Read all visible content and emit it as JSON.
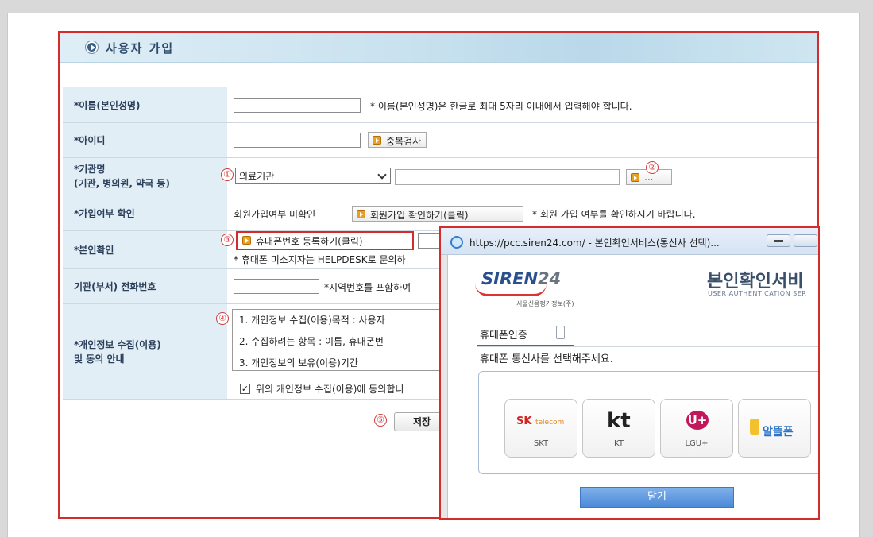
{
  "page": {
    "title": "사용자 가입"
  },
  "form": {
    "name": {
      "label": "*이름(본인성명)",
      "value": "",
      "note": "* 이름(본인성명)은 한글로 최대 5자리 이내에서 입력해야 합니다."
    },
    "userid": {
      "label": "*아이디",
      "value": "",
      "check_button": "중복검사"
    },
    "org": {
      "label_line1": "*기관명",
      "label_line2": "(기관, 병의원, 약국 등)",
      "select_value": "의료기관",
      "input_value": "",
      "search_button": "..."
    },
    "join_check": {
      "label": "*가입여부 확인",
      "status": "회원가입여부 미확인",
      "button": "회원가입 확인하기(클릭)",
      "note": "* 회원 가입 여부를 확인하시기 바랍니다."
    },
    "identity": {
      "label": "*본인확인",
      "button": "휴대폰번호 등록하기(클릭)",
      "note": "* 휴대폰 미소지자는 HELPDESK로 문의하"
    },
    "phone": {
      "label": "기관(부서) 전화번호",
      "value": "",
      "note": "*지역번호를 포함하여 "
    },
    "privacy": {
      "label_line1": "*개인정보 수집(이용)",
      "label_line2": "및 동의 안내",
      "lines": [
        "1. 개인정보 수집(이용)목적 : 사용자",
        "2. 수집하려는 항목 : 이름, 휴대폰번",
        "3. 개인정보의 보유(이용)기간"
      ],
      "agree_label": "위의 개인정보 수집(이용)에 동의합니",
      "agree_checked": true
    },
    "save_button": "저장"
  },
  "markers": [
    "①",
    "②",
    "③",
    "④",
    "⑤"
  ],
  "popup": {
    "window_title": "https://pcc.siren24.com/ - 본인확인서비스(통신사 선택)...",
    "brand": "SIREN",
    "brand_num": "24",
    "brand_sub": "서울신용평가정보(주)",
    "service_title": "본인확인서비",
    "service_sub": "USER AUTHENTICATION SER",
    "tab_label": "휴대폰인증",
    "instruction": "휴대폰 통신사를 선택해주세요.",
    "carriers": [
      {
        "logo": "SK",
        "logo_small": "telecom",
        "name": "SKT"
      },
      {
        "logo": "kt",
        "name": "KT"
      },
      {
        "logo": "U+",
        "name": "LGU+"
      },
      {
        "logo": "알뜰폰",
        "name": ""
      }
    ],
    "close_button": "닫기"
  },
  "colors": {
    "highlight_red": "#d62b2b",
    "label_bg": "#e2eef6",
    "close_blue": "#4d8ad8"
  }
}
